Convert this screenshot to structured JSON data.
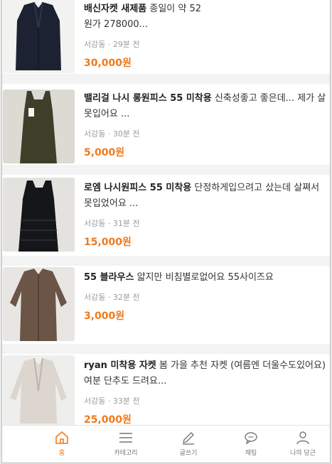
{
  "items": [
    {
      "title": "배신자켓 새제품",
      "body": " 종일이 약 52",
      "line2": "원가 278000...",
      "location": "서강동",
      "time": "29분 전",
      "price": "30,000원"
    },
    {
      "title": "밸리걸 나시 롱원피스 55 미착용",
      "body": " 신축성좋고 좋은데... 제가 살",
      "line2": "못입어요 ...",
      "location": "서강동",
      "time": "30분 전",
      "price": "5,000원"
    },
    {
      "title": "로엠 나시원피스 55 미착용",
      "body": " 단정하게입으려고 샀는데 살쪄서",
      "line2": "못입었어요 ...",
      "location": "서강동",
      "time": "31분 전",
      "price": "15,000원"
    },
    {
      "title": "55 블라우스",
      "body": " 얇지만 비침별로없어요 55사이즈요",
      "line2": "",
      "location": "서강동",
      "time": "32분 전",
      "price": "3,000원"
    },
    {
      "title": "ryan 미착용 자켓",
      "body": " 봄 가을 추천 자켓 (여름엔 더울수도있어요)",
      "line2": "여분 단추도 드려요...",
      "location": "서강동",
      "time": "33분 전",
      "price": "25,000원"
    }
  ],
  "meta_sep": " · ",
  "tabs": [
    {
      "label": "홈",
      "icon": "home-icon"
    },
    {
      "label": "카테고리",
      "icon": "menu-icon"
    },
    {
      "label": "글쓰기",
      "icon": "pencil-icon"
    },
    {
      "label": "채팅",
      "icon": "chat-icon"
    },
    {
      "label": "나의 당근",
      "icon": "person-icon"
    }
  ],
  "colors": {
    "accent": "#f07a1a",
    "text": "#333333",
    "muted": "#9a9a9a"
  }
}
